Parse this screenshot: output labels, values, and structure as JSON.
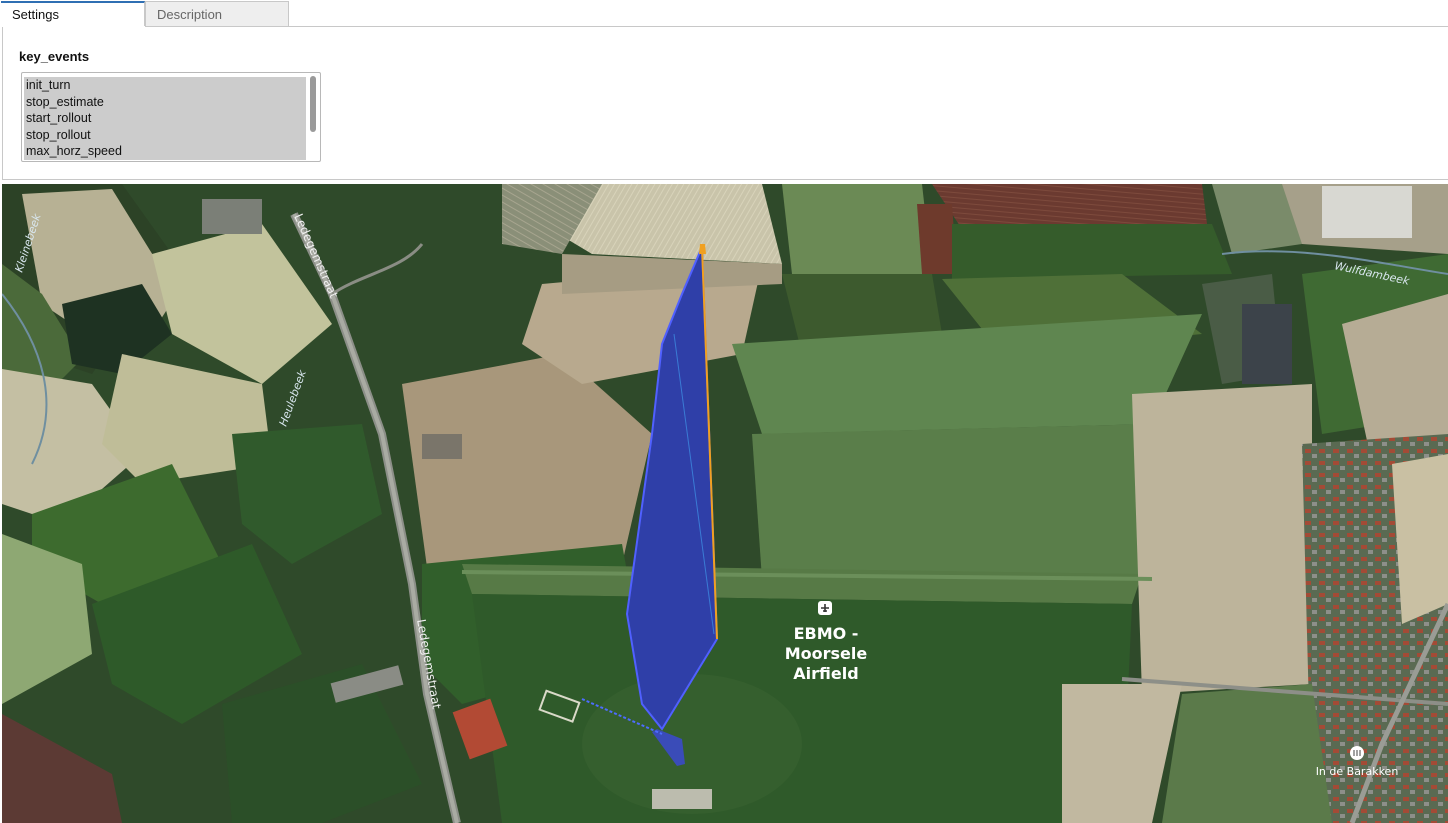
{
  "tabs": [
    {
      "label": "Settings",
      "active": true
    },
    {
      "label": "Description",
      "active": false
    }
  ],
  "settings": {
    "field_label": "key_events",
    "options": [
      "init_turn",
      "stop_estimate",
      "start_rollout",
      "stop_rollout",
      "max_horz_speed"
    ]
  },
  "map": {
    "airfield_icon": "airport-icon",
    "airfield_label": [
      "EBMO -",
      "Moorsele",
      "Airfield"
    ],
    "poi_icon": "restaurant-pin-icon",
    "poi_label": "In de Barakken",
    "streets": {
      "ledegemstraat_north": "Ledegemstraat",
      "ledegemstraat_south": "Ledegemstraat",
      "heulebeek": "Heulebeek",
      "kleinebeek": "Kleinebeek",
      "wulfdambeek": "Wulfdambeek"
    },
    "colors": {
      "trajectory_fill": "#2f3fa8",
      "trajectory_edge": "#5060ff",
      "orange_path": "#f0a020"
    }
  }
}
